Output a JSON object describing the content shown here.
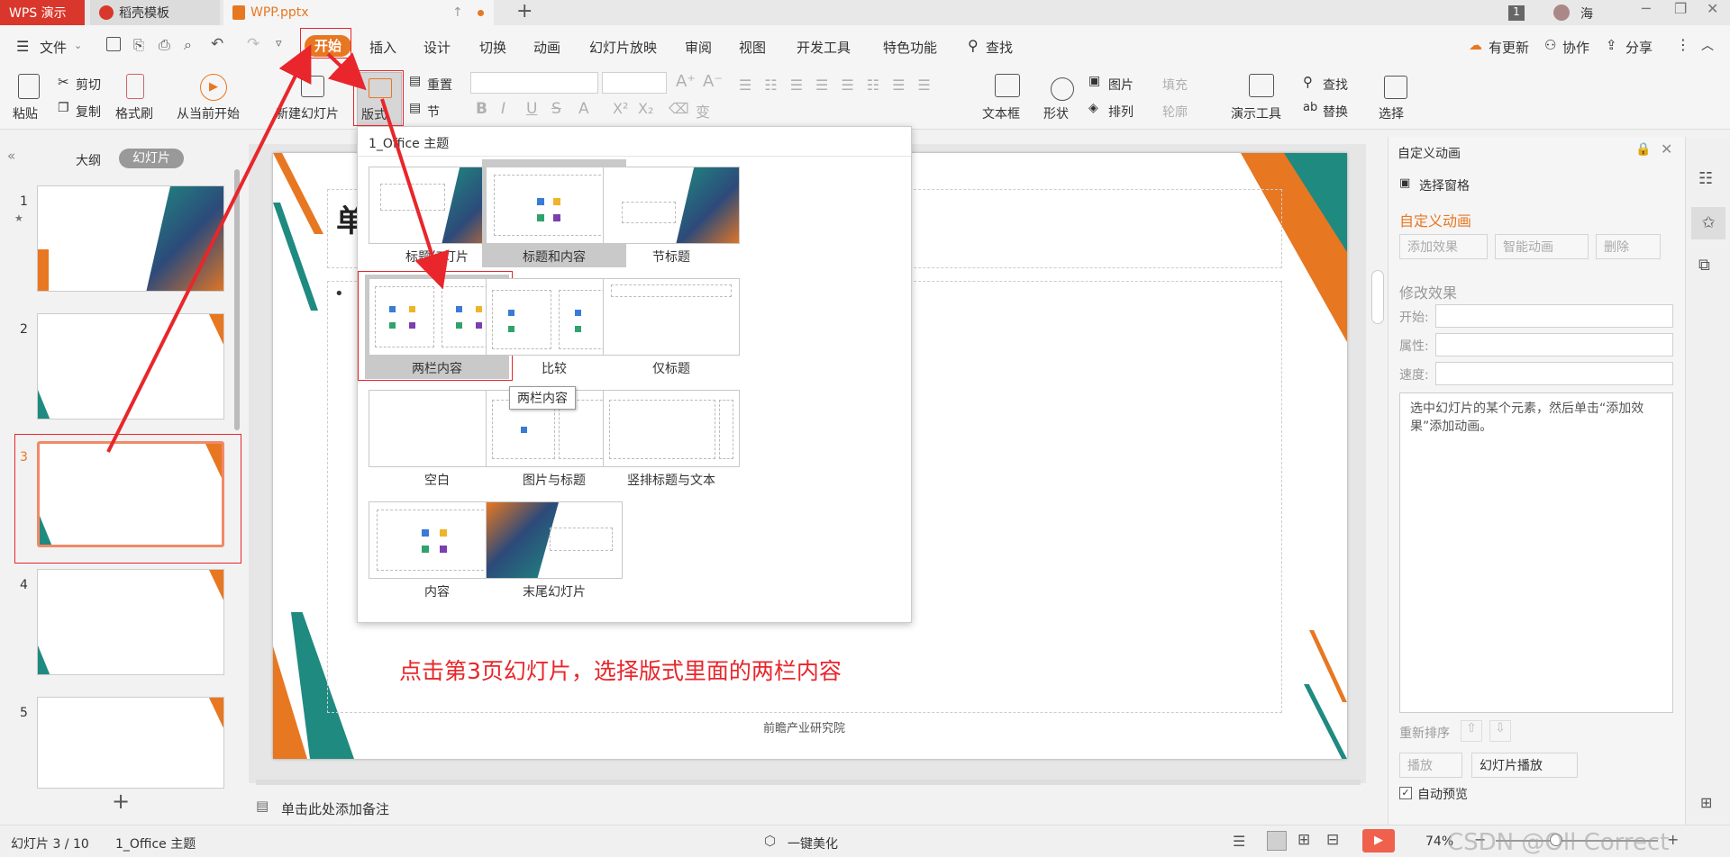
{
  "titlebar": {
    "app_tab": "WPS 演示",
    "template_tab": "稻壳模板",
    "file_tab": "WPP.pptx",
    "new_tab": "+",
    "badge": "1",
    "user_name": "海"
  },
  "menubar": {
    "file": "文件",
    "items": [
      "开始",
      "插入",
      "设计",
      "切换",
      "动画",
      "幻灯片放映",
      "审阅",
      "视图",
      "开发工具",
      "特色功能"
    ],
    "search": "查找",
    "update": "有更新",
    "collab": "协作",
    "share": "分享"
  },
  "ribbon": {
    "paste": "粘贴",
    "cut": "剪切",
    "copy": "复制",
    "format_painter": "格式刷",
    "from_current": "从当前开始",
    "new_slide": "新建幻灯片",
    "layout": "版式",
    "reset": "重置",
    "section": "节",
    "textbox": "文本框",
    "shape": "形状",
    "picture": "图片",
    "fill": "填充",
    "arrange": "排列",
    "outline": "轮廓",
    "presenter_tools": "演示工具",
    "find": "查找",
    "replace": "替换",
    "select": "选择"
  },
  "left_panel": {
    "tab_outline": "大纲",
    "tab_slides": "幻灯片",
    "slide_numbers": [
      "1",
      "2",
      "3",
      "4",
      "5"
    ],
    "star": "★",
    "add": "+"
  },
  "dropdown": {
    "theme_name": "1_Office 主题",
    "layouts": [
      "标题幻灯片",
      "标题和内容",
      "节标题",
      "两栏内容",
      "比较",
      "仅标题",
      "空白",
      "图片与标题",
      "竖排标题与文本",
      "内容",
      "末尾幻灯片"
    ],
    "tooltip": "两栏内容"
  },
  "slide": {
    "title_fragment": "单",
    "bullet": "•",
    "instruction": "点击第3页幻灯片，选择版式里面的两栏内容",
    "footer": "前瞻产业研究院"
  },
  "notes": {
    "placeholder": "单击此处添加备注"
  },
  "right_panel": {
    "header": "自定义动画",
    "selection_pane": "选择窗格",
    "section_title": "自定义动画",
    "add_effect": "添加效果",
    "smart_animation": "智能动画",
    "delete": "删除",
    "modify_effect": "修改效果",
    "start_label": "开始:",
    "property_label": "属性:",
    "speed_label": "速度:",
    "hint": "选中幻灯片的某个元素，然后单击“添加效果”添加动画。",
    "reorder": "重新排序",
    "play": "播放",
    "slideshow": "幻灯片播放",
    "auto_preview": "自动预览"
  },
  "statusbar": {
    "slide_position": "幻灯片 3 / 10",
    "theme": "1_Office 主题",
    "beautify": "一键美化",
    "zoom": "74%",
    "watermark": "CSDN @Oll Correct"
  },
  "colors": {
    "accent_orange": "#e87722",
    "teal": "#1f8a80",
    "red_annotation": "#e8262b",
    "wps_red": "#d9372b"
  }
}
